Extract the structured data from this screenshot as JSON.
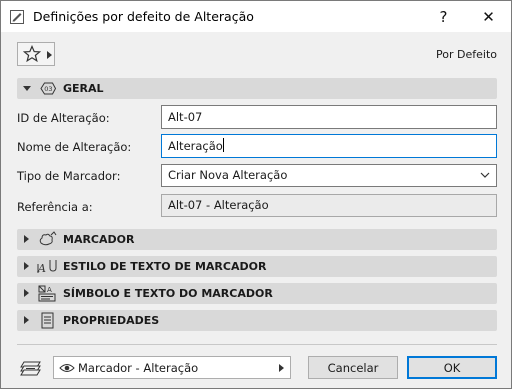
{
  "window": {
    "title": "Definições por defeito de Alteração",
    "help_glyph": "?",
    "close_glyph": "✕"
  },
  "toolbar": {
    "favorites_icon": "star-icon",
    "default_label": "Por Defeito"
  },
  "sections": {
    "general": {
      "label": "GERAL",
      "expanded": true,
      "icon": "revision-tag-icon"
    },
    "marker": {
      "label": "MARCADOR",
      "expanded": false,
      "icon": "marker-cloud-icon"
    },
    "marker_text_style": {
      "label": "ESTILO DE TEXTO DE MARCADOR",
      "expanded": false,
      "icon": "text-style-icon"
    },
    "marker_symbol_text": {
      "label": "SÍMBOLO E TEXTO DO MARCADOR",
      "expanded": false,
      "icon": "symbol-text-icon"
    },
    "properties": {
      "label": "PROPRIEDADES",
      "expanded": false,
      "icon": "document-icon"
    }
  },
  "fields": {
    "change_id": {
      "label": "ID de Alteração:",
      "value": "Alt-07"
    },
    "change_name": {
      "label": "Nome de Alteração:",
      "value": "Alteração"
    },
    "marker_type": {
      "label": "Tipo de Marcador:",
      "value": "Criar Nova Alteração"
    },
    "reference": {
      "label": "Referência a:",
      "value": "Alt-07 - Alteração"
    }
  },
  "footer": {
    "layer_icon": "layer-icon",
    "marker_layer": "Marcador - Alteração",
    "cancel_label": "Cancelar",
    "ok_label": "OK"
  },
  "colors": {
    "accent": "#0078d7",
    "section_bg": "#d9d9d9",
    "dialog_bg": "#f0f0f0"
  }
}
